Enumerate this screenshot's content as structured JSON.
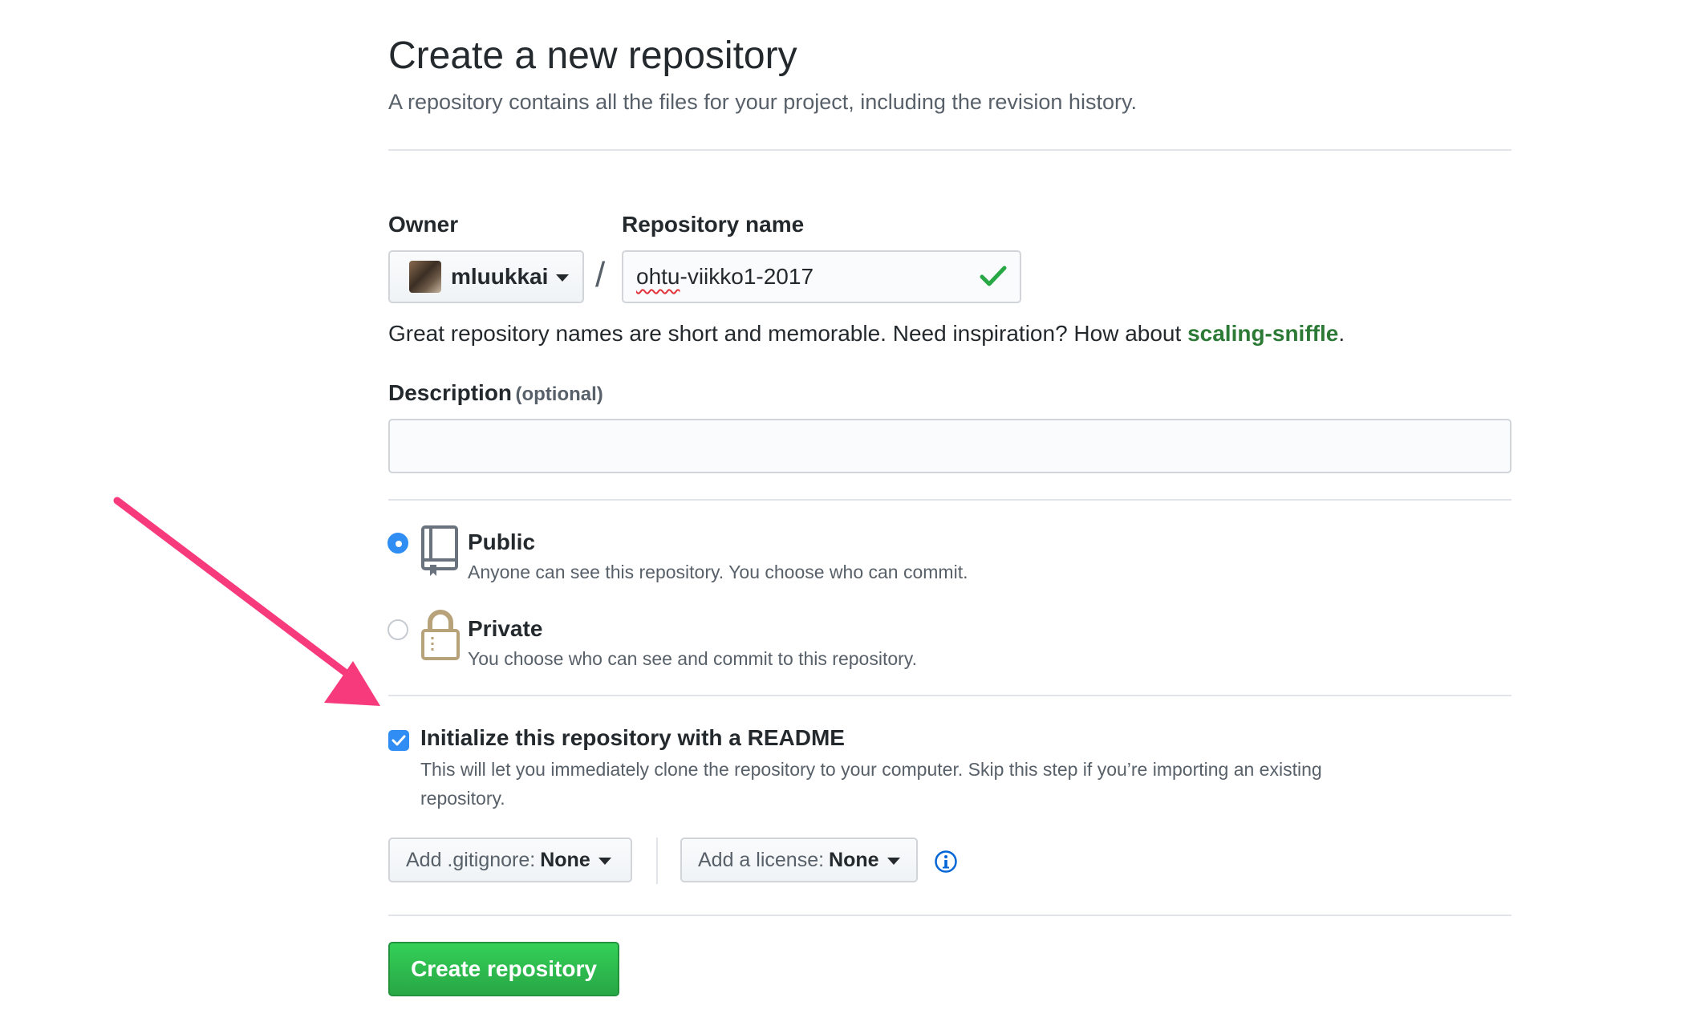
{
  "header": {
    "title": "Create a new repository",
    "subtitle": "A repository contains all the files for your project, including the revision history."
  },
  "owner": {
    "label": "Owner",
    "value": "mluukkai"
  },
  "repo_name": {
    "label": "Repository name",
    "value_part1": "ohtu",
    "value_part2": "-viikko1-2017",
    "separator": "/"
  },
  "hint": {
    "text": "Great repository names are short and memorable. Need inspiration? How about ",
    "suggestion": "scaling-sniffle",
    "end": "."
  },
  "description": {
    "label": "Description",
    "optional": "(optional)",
    "value": ""
  },
  "visibility": {
    "public": {
      "title": "Public",
      "desc": "Anyone can see this repository. You choose who can commit.",
      "selected": true
    },
    "private": {
      "title": "Private",
      "desc": "You choose who can see and commit to this repository.",
      "selected": false
    }
  },
  "readme": {
    "checked": true,
    "title": "Initialize this repository with a README",
    "desc_line1": "This will let you immediately clone the repository to your computer. Skip this step if you’re importing an existing",
    "desc_line2": "repository."
  },
  "gitignore": {
    "label": "Add .gitignore:",
    "value": "None"
  },
  "license": {
    "label": "Add a license:",
    "value": "None"
  },
  "submit": {
    "label": "Create repository"
  },
  "colors": {
    "accent_green": "#28a745",
    "suggestion_green": "#2c7a36",
    "radio_blue": "#2f8df4",
    "annotation_arrow": "#f73a7c",
    "info_blue": "#0366d6"
  },
  "icons": [
    "chevron-down-icon",
    "check-icon",
    "repo-icon",
    "lock-icon",
    "info-icon",
    "checkmark-icon",
    "annotation-arrow"
  ]
}
